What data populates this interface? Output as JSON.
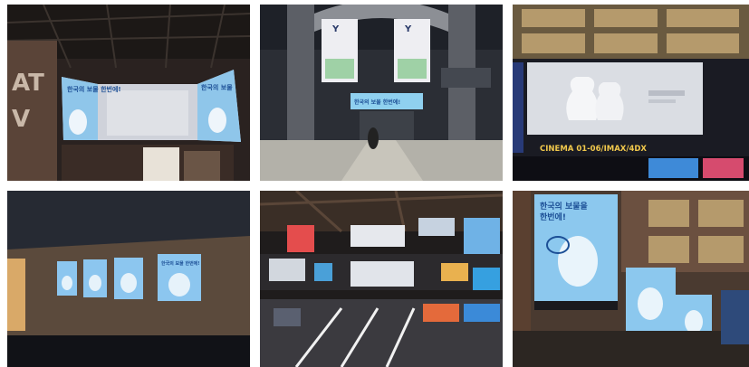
{
  "photos": [
    {
      "name": "photo-theater-lobby-curved-led-wall",
      "signs": {
        "led_left": "한국의 보물 한번에!",
        "led_right": "한국의 보물"
      }
    },
    {
      "name": "photo-atrium-hanging-banners",
      "signs": {
        "banner_left": "Y",
        "banner_right": "Y",
        "screen": "한국의 보물 한번에!"
      }
    },
    {
      "name": "photo-screen-vases-cinema",
      "signs": {
        "sign": "CINEMA 01-06/IMAX/4DX"
      }
    },
    {
      "name": "photo-corridor-lightbox-posters",
      "signs": {
        "poster": "한국의 보물 한번에!"
      }
    },
    {
      "name": "photo-multiplex-lobby-screens",
      "signs": {}
    },
    {
      "name": "photo-hanging-poster-closeup",
      "signs": {
        "headline1": "한국의 보물을",
        "headline2": "한번에!"
      }
    }
  ]
}
